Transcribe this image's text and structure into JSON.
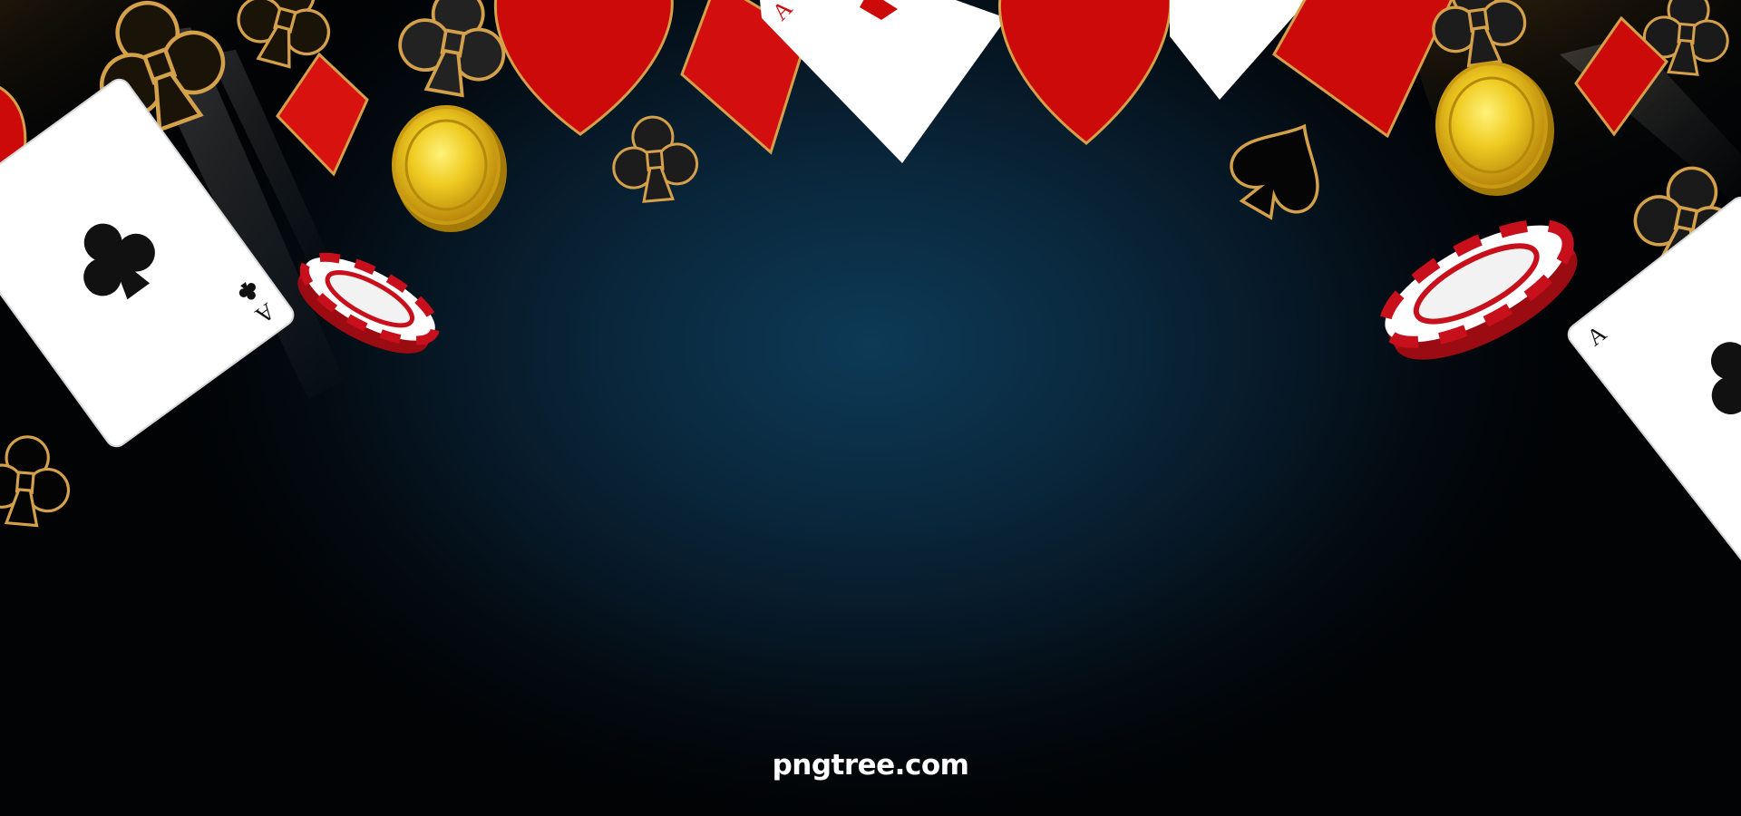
{
  "watermark": {
    "text": "pngtree.com"
  },
  "cards": {
    "left_card_rank": "A",
    "right_card_rank": "A",
    "top_card_rank": "A"
  },
  "colors": {
    "background_center": "#0d3a56",
    "background_edge": "#010305",
    "suit_red": "#cc0a0a",
    "gold_outline": "#d4a04a",
    "coin_gold": "#e8c21a",
    "chip_red": "#c8101c",
    "card_white": "#ffffff"
  },
  "icons": {
    "clubs": "clubs-icon",
    "spades": "spades-icon",
    "hearts": "hearts-icon",
    "diamonds": "diamonds-icon",
    "coin": "gold-coin-icon",
    "chip": "poker-chip-icon"
  }
}
